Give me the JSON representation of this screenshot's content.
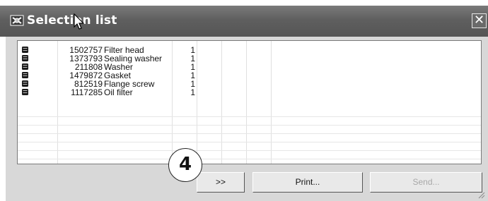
{
  "window": {
    "title": "Selection list",
    "close_glyph": "✕"
  },
  "list": {
    "rows": [
      {
        "number": "1502757",
        "name": "Filter head",
        "qty": "1"
      },
      {
        "number": "1373793",
        "name": "Sealing washer",
        "qty": "1"
      },
      {
        "number": "211808",
        "name": "Washer",
        "qty": "1"
      },
      {
        "number": "1479872",
        "name": "Gasket",
        "qty": "1"
      },
      {
        "number": "812519",
        "name": "Flange screw",
        "qty": "1"
      },
      {
        "number": "1117285",
        "name": "Oil filter",
        "qty": "1"
      }
    ]
  },
  "buttons": {
    "forward_label": ">>",
    "print_label": "Print...",
    "send_label": "Send..."
  },
  "callout": {
    "label": "4"
  },
  "icons": {
    "title": "selection-list-icon",
    "row": "part-icon",
    "pointer": "mouse-pointer-icon"
  },
  "colors": {
    "titlebar": "#5f5f5f",
    "dialog_body": "#d8d8d8",
    "disabled_text": "#a8a8a8"
  }
}
